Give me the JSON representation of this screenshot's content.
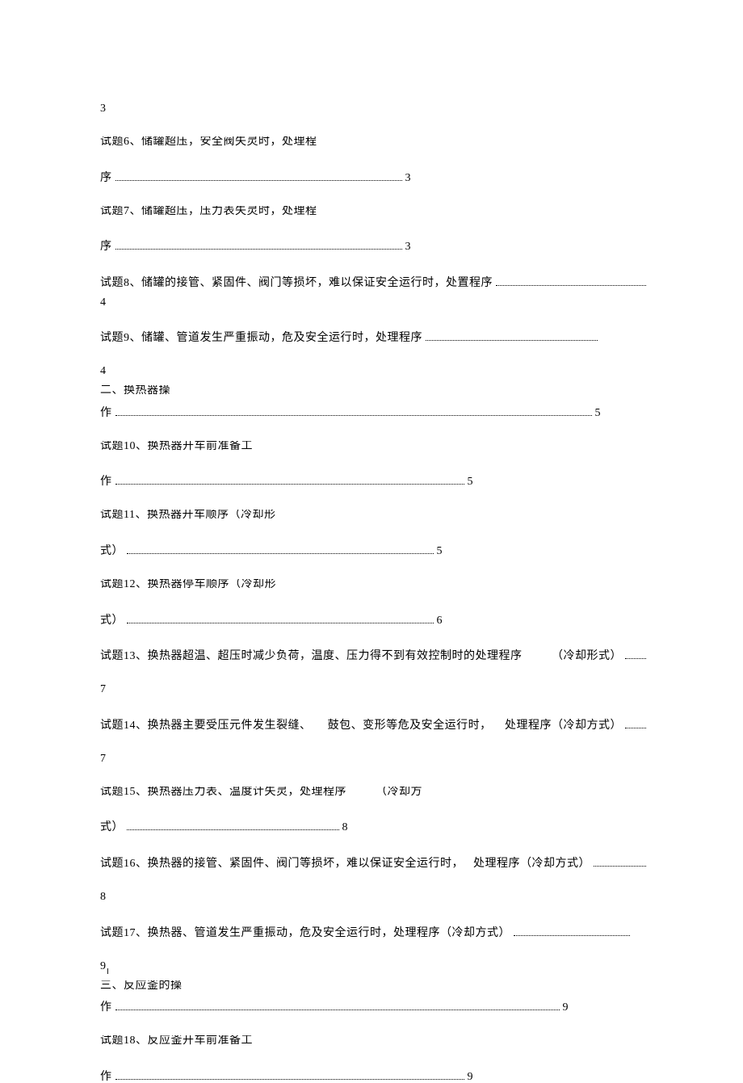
{
  "lines": {
    "l1": "3",
    "l2_a": "试题6、储罐超压，安全阀失灵时，处理程",
    "l3_a": "序",
    "l3_pg": "3",
    "l4_a": "试题7、储罐超压，压力表失灵时，处理程",
    "l5_a": "序",
    "l5_pg": "3",
    "l6_a": "试题8、储罐的接管、紧固件、阀门等损坏，难以保证安全运行时，处置程序  ",
    "l7_a": "4",
    "l8_a": "试题9、储罐、管道发生严重振动，危及安全运行时，处理程序 ",
    "l9_a": "4",
    "l10_a": "二、换热器操",
    "l11_a": "作 ",
    "l11_pg": "5",
    "l12_a": "试题10、换热器开车前准备工",
    "l13_a": "作",
    "l13_pg": "5",
    "l14_a": "试题11、换热器开车顺序（冷却形",
    "l15_a": "式）",
    "l15_pg": "5",
    "l16_a": "试题12、换热器停车顺序（冷却形",
    "l17_a": "式）",
    "l17_pg": "6",
    "l18_a": "试题13、换热器超温、超压时减少负荷，温度、压力得不到有效控制时的处理程序",
    "l18_b": "（冷却形式）",
    "l19_a": "7",
    "l20_a": "试题14、换热器主要受压元件发生裂缝、",
    "l20_b": "鼓包、变形等危及安全运行时，",
    "l20_c": "处理程序（冷却方式）",
    "l21_a": "7",
    "l22_a": "试题15、换热器压力表、温度计失灵，处理程序",
    "l22_b": "（冷却方",
    "l23_a": "式）",
    "l23_pg": "8",
    "l24_a": "试题16、换热器的接管、紧固件、阀门等损坏，难以保证安全运行时，",
    "l24_b": "处理程序（冷却方式）",
    "l25_a": "8",
    "l26_a": "试题17、换热器、管道发生严重振动，危及安全运行时，处理程序（冷却方式）  ",
    "l27_a": "9",
    "l28_a": "三、反应釜的操",
    "l29_a": "作 ",
    "l29_pg": "9",
    "l30_a": "试题18、反应釜开车前准备工",
    "l31_a": "作",
    "l31_pg": "9"
  },
  "marker": "I"
}
